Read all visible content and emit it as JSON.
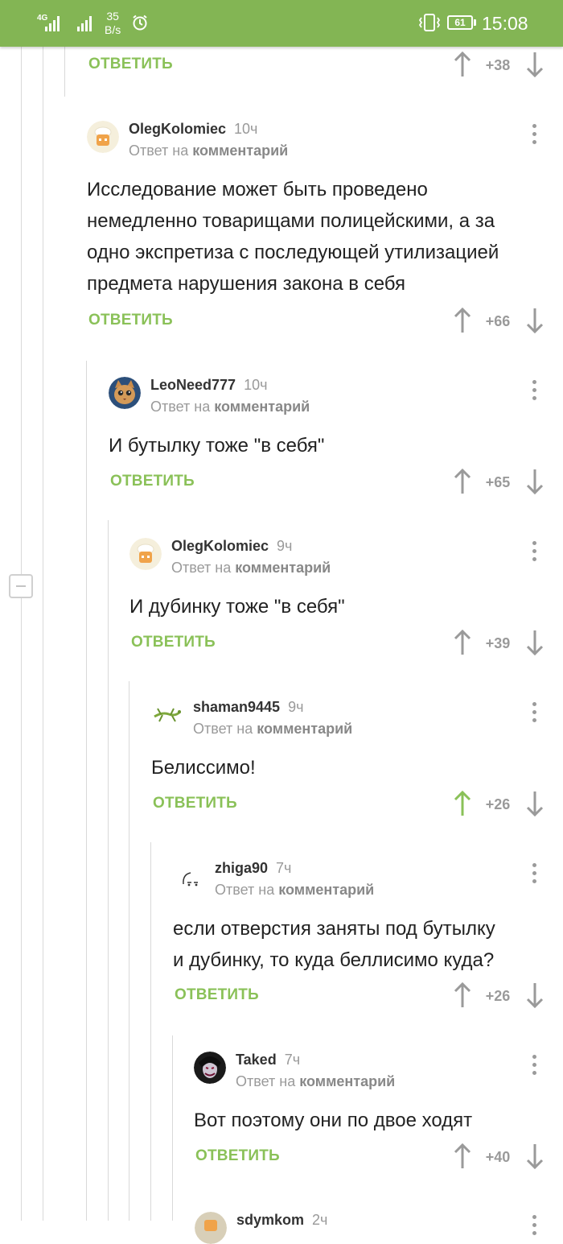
{
  "status_bar": {
    "network_1": "4G",
    "speed_value": "35",
    "speed_unit": "B/s",
    "battery": "61",
    "time": "15:08"
  },
  "reply_label": "ОТВЕТИТЬ",
  "reply_prefix": "Ответ на",
  "reply_target": "комментарий",
  "top_actions": {
    "votes": "+38"
  },
  "comments": [
    {
      "author": "OlegKolomiec",
      "age": "10ч",
      "lines": [
        "Исследование может быть проведено",
        "немедленно товарищами полицейскими, а за",
        "одно экспретиза с последующей утилизацией",
        "предмета нарушения закона в себя"
      ],
      "votes": "+66"
    },
    {
      "author": "LeoNeed777",
      "age": "10ч",
      "lines": [
        "И бутылку тоже \"в себя\""
      ],
      "votes": "+65"
    },
    {
      "author": "OlegKolomiec",
      "age": "9ч",
      "lines": [
        "И дубинку тоже \"в себя\""
      ],
      "votes": "+39"
    },
    {
      "author": "shaman9445",
      "age": "9ч",
      "lines": [
        "Белиссимо!"
      ],
      "votes": "+26",
      "upvoted": true
    },
    {
      "author": "zhiga90",
      "age": "7ч",
      "lines": [
        "если отверстия заняты под бутылку",
        "и дубинку, то куда беллисимо куда?"
      ],
      "votes": "+26"
    },
    {
      "author": "Taked",
      "age": "7ч",
      "lines": [
        "Вот поэтому они по двое ходят"
      ],
      "votes": "+40"
    },
    {
      "author": "sdymkom",
      "age": "2ч",
      "lines": [],
      "votes": ""
    }
  ],
  "colors": {
    "accent": "#83b554",
    "reply_green": "#8ac158",
    "upvoted_green": "#8ac158",
    "muted": "#9a9a9a"
  }
}
